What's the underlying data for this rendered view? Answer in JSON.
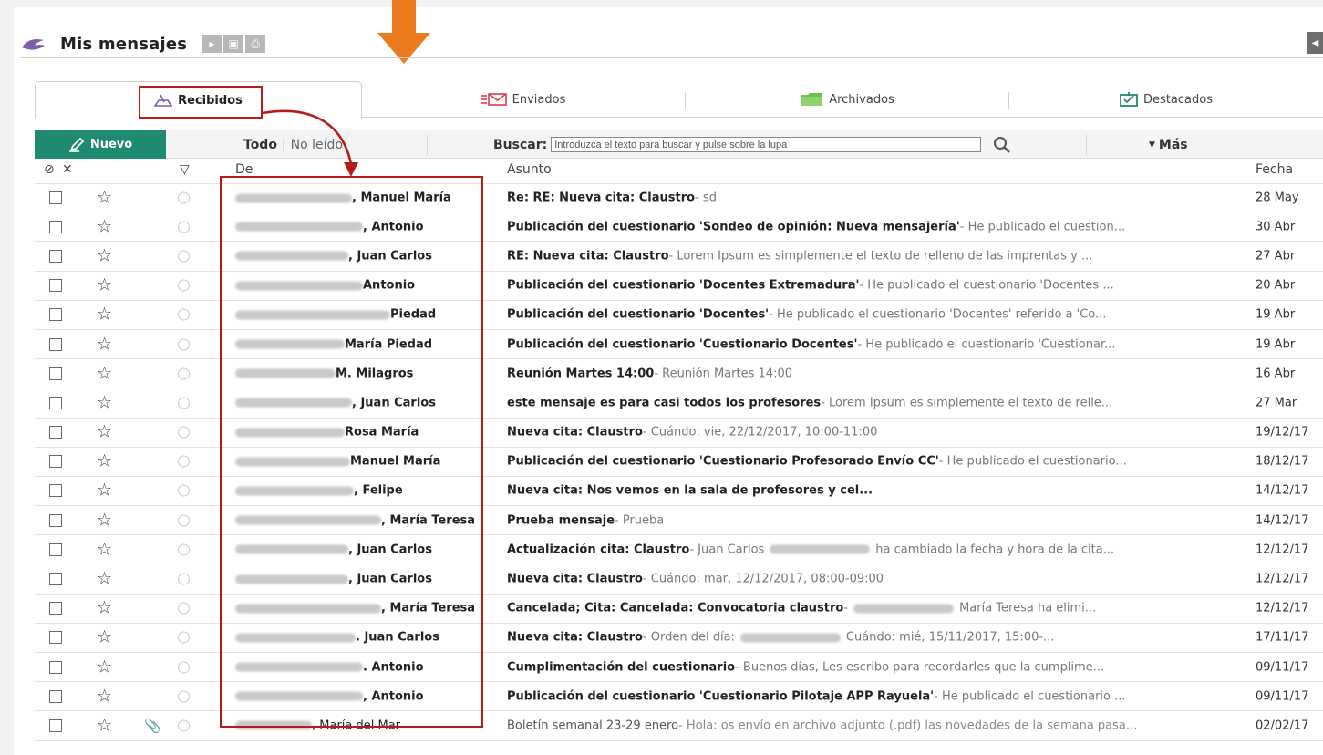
{
  "header": {
    "title": "Mis mensajes",
    "buttons": [
      "forward-icon",
      "export-icon",
      "print-icon"
    ],
    "accent": "#7b5fa8"
  },
  "tabs": [
    {
      "label": "Recibidos",
      "icon": "inbox-tray-icon",
      "active": true
    },
    {
      "label": "Enviados",
      "icon": "envelope-send-icon",
      "active": false
    },
    {
      "label": "Archivados",
      "icon": "folder-icon",
      "active": false
    },
    {
      "label": "Destacados",
      "icon": "flag-icon",
      "active": false
    }
  ],
  "toolbar": {
    "new_label": "Nuevo",
    "new_color": "#1f8a72",
    "filter_all": "Todo",
    "filter_sep": "|",
    "filter_unread": "No leído",
    "search_label": "Buscar:",
    "search_placeholder": "Introduzca el texto para buscar y pulse sobre la lupa",
    "more_label": "Más"
  },
  "columns": {
    "from": "De",
    "subject": "Asunto",
    "date": "Fecha"
  },
  "messages": [
    {
      "from": ", Manuel María",
      "subject": "Re: RE: Nueva cita: Claustro",
      "preview": " - sd",
      "date": "28 May"
    },
    {
      "from": ", Antonio",
      "subject": "Publicación del cuestionario 'Sondeo de opinión: Nueva mensajería'",
      "preview": " - He publicado el cuestion...",
      "date": "30 Abr"
    },
    {
      "from": ", Juan Carlos",
      "subject": "RE: Nueva cita: Claustro",
      "preview": " - Lorem Ipsum es simplemente el texto de relleno de las imprentas y ...",
      "date": "27 Abr"
    },
    {
      "from": "Antonio",
      "subject": "Publicación del cuestionario 'Docentes Extremadura'",
      "preview": " - He publicado el cuestionario 'Docentes ...",
      "date": "20 Abr"
    },
    {
      "from": "Piedad",
      "subject": "Publicación del cuestionario 'Docentes'",
      "preview": " - He publicado el cuestionario 'Docentes' referido a 'Co...",
      "date": "19 Abr"
    },
    {
      "from": "María Piedad",
      "subject": "Publicación del cuestionario 'Cuestionario Docentes'",
      "preview": " - He publicado el cuestionario 'Cuestionar...",
      "date": "19 Abr"
    },
    {
      "from": "M. Milagros",
      "subject": "Reunión Martes 14:00",
      "preview": " - Reunión Martes 14:00",
      "date": "16 Abr"
    },
    {
      "from": ", Juan Carlos",
      "subject": "este mensaje es para casi todos los profesores",
      "preview": " - Lorem Ipsum es simplemente el texto de relle...",
      "date": "27 Mar"
    },
    {
      "from": "Rosa María",
      "subject": "Nueva cita: Claustro",
      "preview": " - Cuándo: vie, 22/12/2017, 10:00-11:00",
      "date": "19/12/17"
    },
    {
      "from": "Manuel María",
      "subject": "Publicación del cuestionario 'Cuestionario Profesorado Envío CC'",
      "preview": " - He publicado el cuestionario...",
      "date": "18/12/17"
    },
    {
      "from": ", Felipe",
      "subject": "Nueva cita:  Nos vemos en la sala de profesores y cel...",
      "preview": "",
      "date": "14/12/17"
    },
    {
      "from": ", María Teresa",
      "subject": "Prueba mensaje",
      "preview": " - Prueba",
      "date": "14/12/17"
    },
    {
      "from": ", Juan Carlos",
      "subject": "Actualización cita: Claustro",
      "preview": " - Juan Carlos ",
      "preview2": "ha cambiado la fecha y hora de la cita...",
      "date": "12/12/17"
    },
    {
      "from": ", Juan Carlos",
      "subject": "Nueva cita: Claustro",
      "preview": " - Cuándo: mar, 12/12/2017, 08:00-09:00",
      "date": "12/12/17"
    },
    {
      "from": ", María Teresa",
      "subject": "Cancelada; Cita: Cancelada: Convocatoria claustro",
      "preview": " - ",
      "preview2": "María Teresa ha elimi...",
      "date": "12/12/17"
    },
    {
      "from": ". Juan Carlos",
      "subject": "Nueva cita: Claustro",
      "preview": " - Orden del día:",
      "preview2": "Cuándo: mié, 15/11/2017, 15:00-...",
      "date": "17/11/17"
    },
    {
      "from": ". Antonio",
      "subject": "Cumplimentación del cuestionario",
      "preview": " - Buenos días, Les escribo para recordarles que la cumplime...",
      "date": "09/11/17"
    },
    {
      "from": ", Antonio",
      "subject": "Publicación del cuestionario 'Cuestionario Pilotaje APP Rayuela'",
      "preview": " - He publicado el cuestionario ...",
      "date": "09/11/17"
    },
    {
      "from": ", María del Mar",
      "subject": "Boletín semanal 23-29 enero",
      "preview": " - Hola: os envío en archivo adjunto (.pdf) las novedades de la semana pasa...",
      "date": "02/02/17",
      "read": true,
      "attachment": true
    }
  ]
}
